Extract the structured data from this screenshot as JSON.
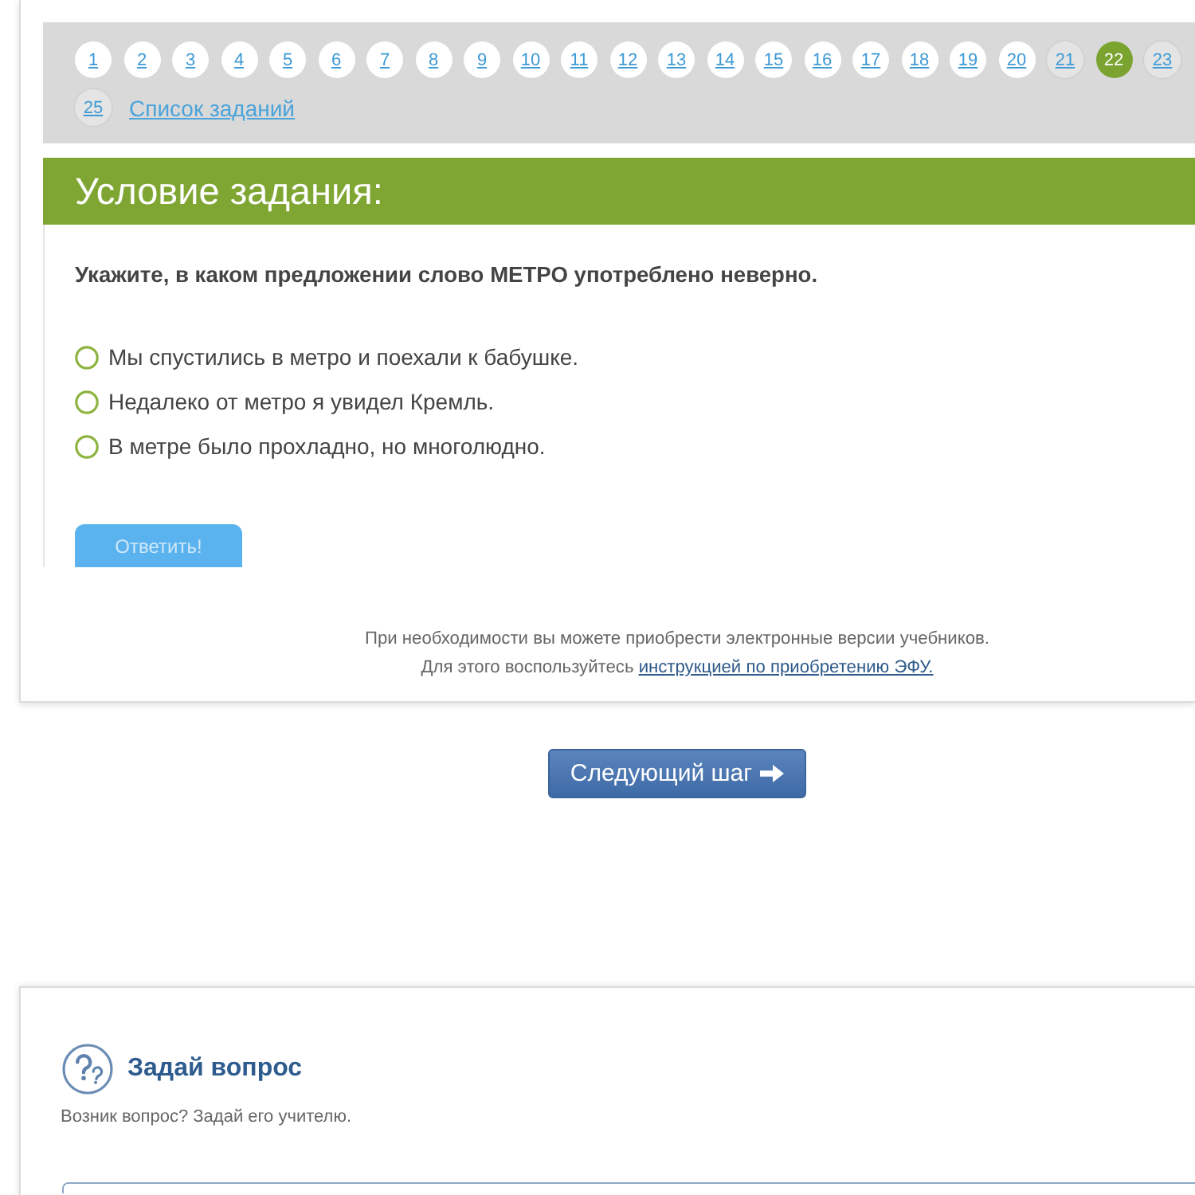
{
  "task_nav": {
    "items": [
      {
        "label": "1",
        "selected": false,
        "visited": false
      },
      {
        "label": "2",
        "selected": false,
        "visited": false
      },
      {
        "label": "3",
        "selected": false,
        "visited": false
      },
      {
        "label": "4",
        "selected": false,
        "visited": false
      },
      {
        "label": "5",
        "selected": false,
        "visited": false
      },
      {
        "label": "6",
        "selected": false,
        "visited": false
      },
      {
        "label": "7",
        "selected": false,
        "visited": false
      },
      {
        "label": "8",
        "selected": false,
        "visited": false
      },
      {
        "label": "9",
        "selected": false,
        "visited": false
      },
      {
        "label": "10",
        "selected": false,
        "visited": false
      },
      {
        "label": "11",
        "selected": false,
        "visited": false
      },
      {
        "label": "12",
        "selected": false,
        "visited": false
      },
      {
        "label": "13",
        "selected": false,
        "visited": false
      },
      {
        "label": "14",
        "selected": false,
        "visited": false
      },
      {
        "label": "15",
        "selected": false,
        "visited": false
      },
      {
        "label": "16",
        "selected": false,
        "visited": false
      },
      {
        "label": "17",
        "selected": false,
        "visited": false
      },
      {
        "label": "18",
        "selected": false,
        "visited": false
      },
      {
        "label": "19",
        "selected": false,
        "visited": false
      },
      {
        "label": "20",
        "selected": false,
        "visited": false
      },
      {
        "label": "21",
        "selected": false,
        "visited": true
      },
      {
        "label": "22",
        "selected": true,
        "visited": false
      },
      {
        "label": "23",
        "selected": false,
        "visited": true
      },
      {
        "label": "25",
        "selected": false,
        "visited": true
      }
    ],
    "list_link": "Список заданий"
  },
  "task": {
    "heading": "Условие задания:",
    "question": "Укажите, в каком предложении слово МЕТРО употреблено неверно.",
    "options": [
      {
        "text": "Мы спустились в метро и поехали к бабушке.",
        "selected": false
      },
      {
        "text": "Недалеко от метро я увидел Кремль.",
        "selected": false
      },
      {
        "text": "В метре было прохладно, но многолюдно.",
        "selected": false
      }
    ],
    "submit": {
      "label": "Ответить!",
      "disabled": true
    }
  },
  "notice": {
    "line_1": "При необходимости вы можете приобрести электронные версии учебников.",
    "line_2": "Для этого воспользуйтесь ",
    "link": "инструкцией по приобретению ЭФУ."
  },
  "next_button": "Следующий шаг",
  "ask": {
    "title": "Задай вопрос",
    "subtitle": "Возник вопрос? Задай его учителю."
  }
}
